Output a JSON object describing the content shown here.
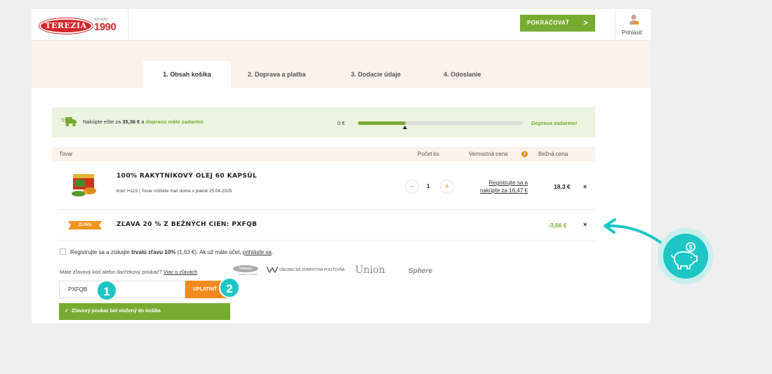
{
  "header": {
    "logo_text": "TEREZIA",
    "since_small": "od roku",
    "since_year": "1990",
    "continue_label": "POKRAČOVAŤ",
    "continue_chevron": ">",
    "login_label": "Prihlásiť"
  },
  "steps": [
    {
      "label": "1. Obsah košíka",
      "active": true
    },
    {
      "label": "2. Doprava a platba",
      "active": false
    },
    {
      "label": "3. Dodacie údaje",
      "active": false
    },
    {
      "label": "4. Odoslanie",
      "active": false
    }
  ],
  "shipping": {
    "text_prefix": "Nakúpte ešte za ",
    "amount": "35,36 €",
    "text_mid": " a ",
    "link_text": "dopravu máte zadarmo",
    "start_label": "0 €",
    "end_label": "Doprava zadarmo!",
    "progress": 0.29
  },
  "table": {
    "col_product": "Tovar",
    "col_qty": "Počet ks",
    "col_loyalty": "Vernostná cena",
    "loyalty_info": "i",
    "col_price": "Bežná cena"
  },
  "product": {
    "name": "100% RAKYTNÍKOVÝ OLEJ 60 KAPSÚL",
    "meta": "Kód: H115 | Tovar môžete mať doma v piatok 25.04.2025",
    "qty": "1",
    "minus": "−",
    "plus": "+",
    "loyalty_line1": "Registrujte sa a",
    "loyalty_line2": "nakúpte za 16,47 €",
    "price": "18,3 €",
    "remove": "×"
  },
  "discount": {
    "tag": "ZĽAVA",
    "name": "ZĽAVA 20 % Z BEŽNÝCH CIEN: PXFQB",
    "value": "-3,66 €",
    "remove": "×"
  },
  "register": {
    "text1": "Registrujte sa a získajte ",
    "bold": "trvalú zľavu 10%",
    "text2": " (1,63 €). Ak už máte účet, ",
    "link": "prihláste sa",
    "text3": "."
  },
  "code": {
    "question": "Máte zľavový kód alebo darčekový poukaz? ",
    "more_link": "Viac o zľavách",
    "input_value": "PXFQB",
    "apply_label": "UPLATNIŤ",
    "success": "Zľavový poukaz bol vložený do košíka"
  },
  "partners": {
    "terezia": "TEREZIA",
    "terezia_sub": "zdravie z prírody",
    "vszp": "VŠEOBECNÁ ZDRAVOTNÁ POISŤOVŇA",
    "union": "Union",
    "sphere": "Sphere"
  },
  "annotations": {
    "badge1": "1",
    "badge2": "2",
    "piggy_icon": "piggy-bank-icon",
    "arrow_icon": "arrow-icon"
  },
  "colors": {
    "brand_red": "#d3262b",
    "green": "#78ab32",
    "orange": "#f39421",
    "teal": "#1ec6c6",
    "band": "#fbf2ec"
  }
}
